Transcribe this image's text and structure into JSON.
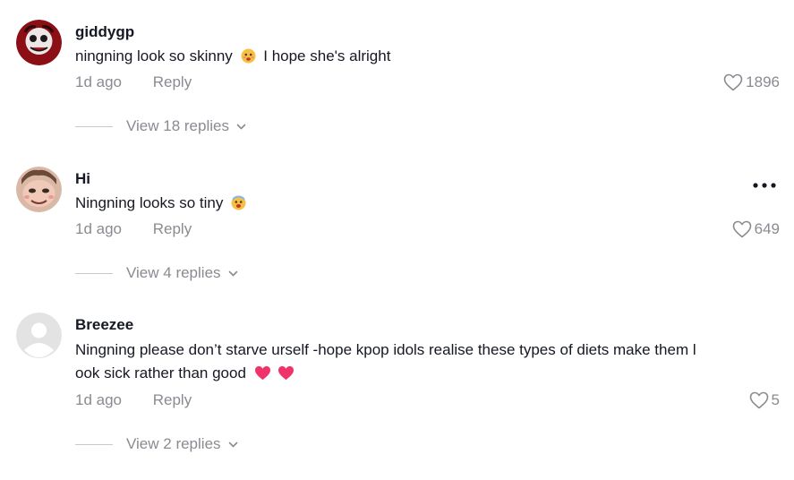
{
  "comments": [
    {
      "username": "giddygp",
      "text_before": "ningning look so skinny",
      "emoji": "worried-face",
      "text_after": "I hope she's alright",
      "time": "1d ago",
      "reply_label": "Reply",
      "likes": "1896",
      "view_replies": "View 18 replies"
    },
    {
      "username": "Hi",
      "text_before": "Ningning looks so tiny",
      "emoji": "fearful-face",
      "text_after": "",
      "time": "1d ago",
      "reply_label": "Reply",
      "likes": "649",
      "view_replies": "View 4 replies"
    },
    {
      "username": "Breezee",
      "text_line1": "Ningning please don’t starve urself -hope kpop idols realise these types of diets make them l",
      "text_line2": "ook sick rather than good",
      "emoji": "pink-hearts",
      "time": "1d ago",
      "reply_label": "Reply",
      "likes": "5",
      "view_replies": "View 2 replies"
    }
  ],
  "colors": {
    "primary_text": "#161823",
    "secondary_text": "#8a8b91",
    "heart_emoji": "#fe2c55"
  }
}
